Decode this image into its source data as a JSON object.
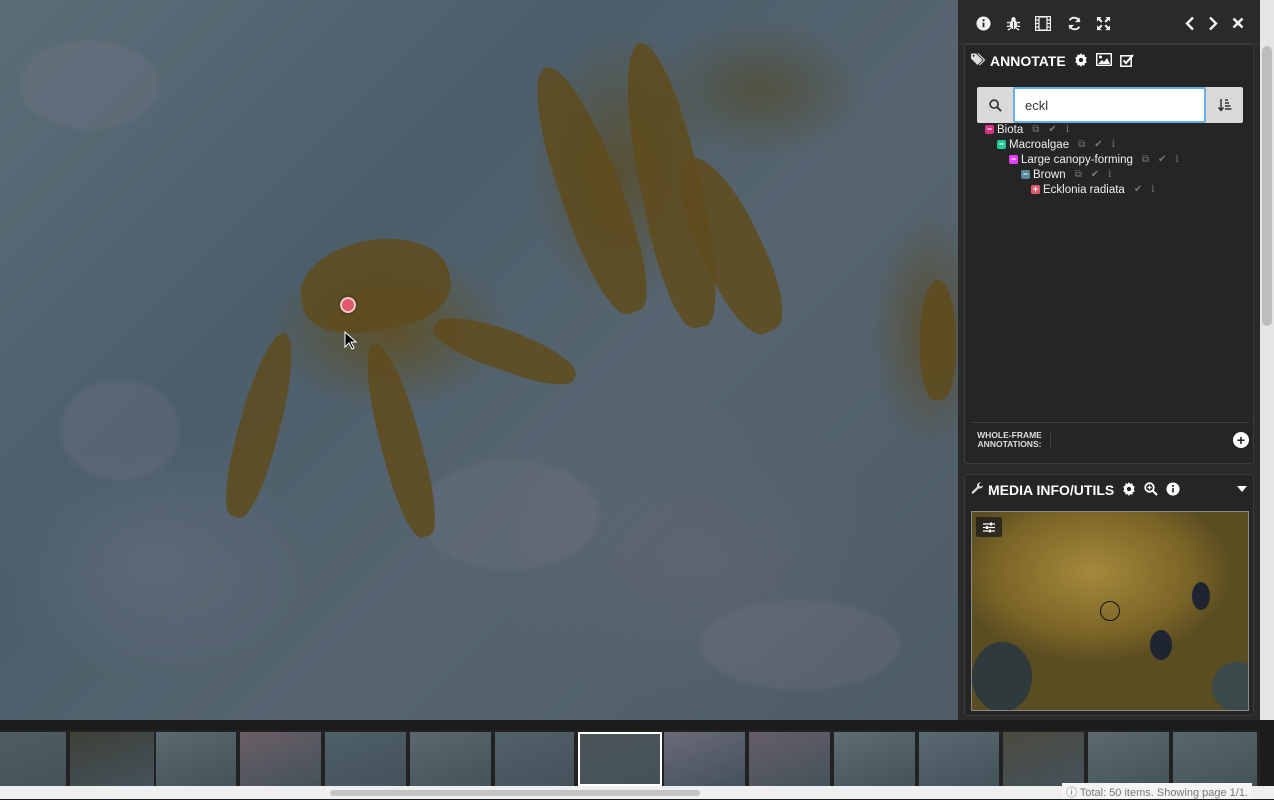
{
  "toolbar": {
    "buttons": [
      "info-icon",
      "bug-icon",
      "film-icon",
      "refresh-icon",
      "expand-icon",
      "chevron-left-icon",
      "chevron-right-icon",
      "close-icon"
    ]
  },
  "annotate": {
    "title": "ANNOTATE",
    "search_value": "eckl",
    "tree": [
      {
        "label": "Biota",
        "color": "#d63384",
        "expanded": true
      },
      {
        "label": "Macroalgae",
        "color": "#20c997",
        "expanded": true
      },
      {
        "label": "Large canopy-forming",
        "color": "#e040fb",
        "expanded": true
      },
      {
        "label": "Brown",
        "color": "#5a8a9a",
        "expanded": true
      },
      {
        "label": "Ecklonia radiata",
        "color": "#e05a6c",
        "expanded": false
      }
    ],
    "whole_frame_label_1": "WHOLE-FRAME",
    "whole_frame_label_2": "ANNOTATIONS:"
  },
  "media": {
    "title": "MEDIA INFO/UTILS"
  },
  "filmstrip": {
    "selected_index": 7,
    "count": 15
  },
  "footer": {
    "total_text": "Total: 50 items. Showing page 1/1."
  },
  "colors": {
    "point": "#e05a6c",
    "search_focus": "#66afe9"
  }
}
